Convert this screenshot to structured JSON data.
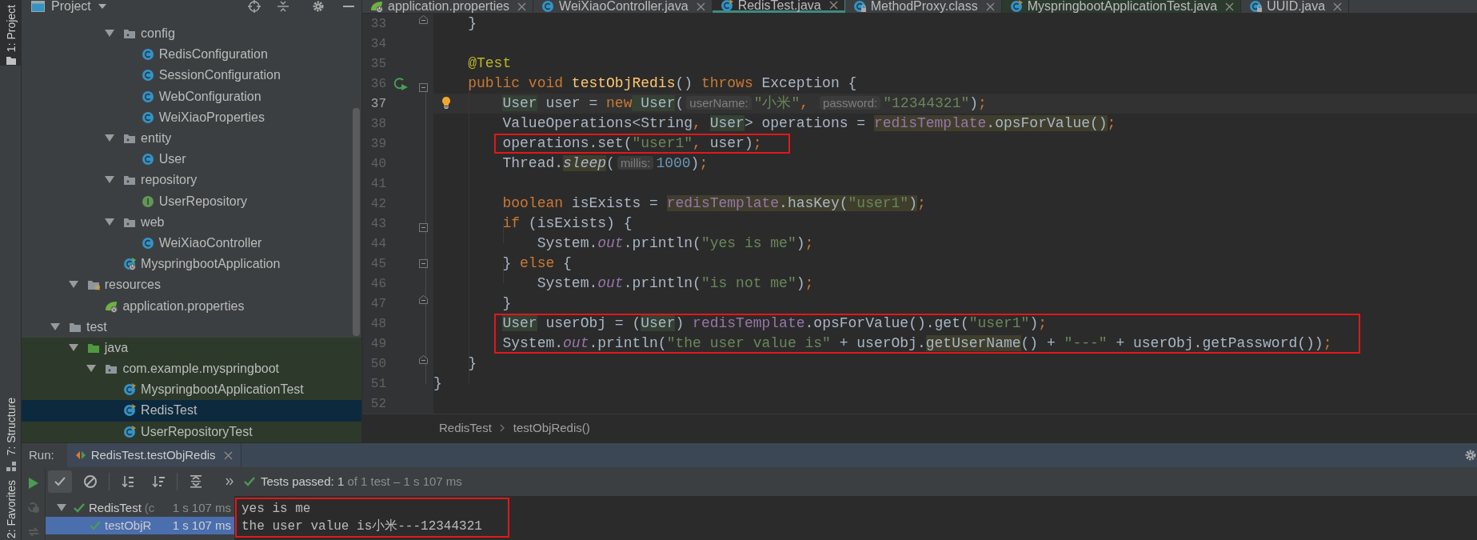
{
  "tool_stripe": {
    "top": [
      {
        "label": "1: Project",
        "selected": true
      }
    ],
    "bottom": [
      {
        "label": "7: Structure",
        "selected": false
      },
      {
        "label": "2: Favorites",
        "selected": false
      }
    ]
  },
  "project_panel": {
    "title": "Project",
    "tree": {
      "main_package_children": [
        {
          "label": "config",
          "kind": "package",
          "expanded": true,
          "selected": false,
          "children": [
            {
              "label": "RedisConfiguration",
              "kind": "class",
              "selected": false
            },
            {
              "label": "SessionConfiguration",
              "kind": "class",
              "selected": false
            },
            {
              "label": "WebConfiguration",
              "kind": "class",
              "selected": false
            },
            {
              "label": "WeiXiaoProperties",
              "kind": "class",
              "selected": false
            }
          ]
        },
        {
          "label": "entity",
          "kind": "package",
          "expanded": true,
          "selected": false,
          "children": [
            {
              "label": "User",
              "kind": "class",
              "selected": false
            }
          ]
        },
        {
          "label": "repository",
          "kind": "package",
          "expanded": true,
          "selected": false,
          "children": [
            {
              "label": "UserRepository",
              "kind": "interface",
              "selected": false
            }
          ]
        },
        {
          "label": "web",
          "kind": "package",
          "expanded": true,
          "selected": false,
          "children": [
            {
              "label": "WeiXiaoController",
              "kind": "class",
              "selected": false
            }
          ]
        },
        {
          "label": "MyspringbootApplication",
          "kind": "spring_app",
          "selected": false
        }
      ],
      "main_folders": [
        {
          "label": "resources",
          "kind": "resources_folder",
          "expanded": true,
          "selected": false,
          "children": [
            {
              "label": "application.properties",
              "kind": "spring_properties",
              "selected": false
            }
          ]
        }
      ],
      "roots": [
        {
          "label": "test",
          "kind": "folder",
          "expanded": true,
          "selected": false,
          "children": [
            {
              "label": "java",
              "kind": "test_sources_root",
              "expanded": true,
              "selected": false,
              "children": [
                {
                  "label": "com.example.myspringboot",
                  "kind": "package",
                  "expanded": true,
                  "selected": false,
                  "children": [
                    {
                      "label": "MyspringbootApplicationTest",
                      "kind": "test_class",
                      "selected": false
                    },
                    {
                      "label": "RedisTest",
                      "kind": "test_class",
                      "selected": true
                    },
                    {
                      "label": "UserRepositoryTest",
                      "kind": "test_class",
                      "selected": false
                    }
                  ]
                }
              ]
            }
          ]
        }
      ]
    }
  },
  "editor": {
    "tabs": [
      {
        "label": "application.properties",
        "kind": "spring_properties",
        "selected": false
      },
      {
        "label": "WeiXiaoController.java",
        "kind": "class",
        "selected": false
      },
      {
        "label": "RedisTest.java",
        "kind": "test_class",
        "selected": true
      },
      {
        "label": "MethodProxy.class",
        "kind": "library_class",
        "selected": false
      },
      {
        "label": "MyspringbootApplicationTest.java",
        "kind": "test_class",
        "selected": false
      },
      {
        "label": "UUID.java",
        "kind": "library_class",
        "selected": false
      }
    ],
    "lines": [
      {
        "number": "33",
        "current": false,
        "boxed": false,
        "fold": {
          "kind": "end"
        },
        "tokens": [
          {
            "kind": "plain",
            "text": "    }"
          }
        ]
      },
      {
        "number": "34",
        "current": false,
        "boxed": false
      },
      {
        "number": "35",
        "current": false,
        "boxed": false,
        "tokens": [
          {
            "kind": "annotation",
            "text": "    @Test"
          }
        ]
      },
      {
        "number": "36",
        "current": false,
        "boxed": false,
        "fold": {
          "kind": "start"
        },
        "gutter_icon": {
          "kind": "run"
        },
        "tokens": [
          {
            "kind": "kw",
            "text": "    public void"
          },
          {
            "kind": "method_decl",
            "text": " testObjRedis"
          },
          {
            "kind": "plain",
            "text": "() "
          },
          {
            "kind": "kw",
            "text": "throws"
          },
          {
            "kind": "plain",
            "text": " Exception {"
          }
        ]
      },
      {
        "number": "37",
        "current": true,
        "boxed": false,
        "gutter_icon": {
          "kind": "bulb"
        },
        "tokens": [
          {
            "kind": "type_hl",
            "text": "        User"
          },
          {
            "kind": "plain",
            "text": " user = "
          },
          {
            "kind": "kw",
            "text": "new"
          },
          {
            "kind": "type_hl",
            "text": " User"
          },
          {
            "kind": "plain",
            "text": "("
          },
          {
            "kind": "hint",
            "text": "userName:"
          },
          {
            "kind": "string",
            "text": "\"小米\""
          },
          {
            "kind": "punct",
            "text": ", "
          },
          {
            "kind": "hint",
            "text": "password:"
          },
          {
            "kind": "string",
            "text": "\"12344321\""
          },
          {
            "kind": "plain",
            "text": ")"
          },
          {
            "kind": "punct",
            "text": ";"
          }
        ]
      },
      {
        "number": "38",
        "current": false,
        "boxed": false,
        "tokens": [
          {
            "kind": "plain",
            "text": "        ValueOperations<String"
          },
          {
            "kind": "punct",
            "text": ", "
          },
          {
            "kind": "type_hl",
            "text": "User"
          },
          {
            "kind": "plain",
            "text": "> operations = "
          },
          {
            "kind": "field_hl",
            "text": "redisTemplate"
          },
          {
            "kind": "plain_hl",
            "text": ".opsForValue()"
          },
          {
            "kind": "punct",
            "text": ";"
          }
        ]
      },
      {
        "number": "39",
        "current": false,
        "boxed": true,
        "tokens": [
          {
            "kind": "plain",
            "text": "        operations.set("
          },
          {
            "kind": "string",
            "text": "\"user1\""
          },
          {
            "kind": "punct",
            "text": ", "
          },
          {
            "kind": "plain",
            "text": "user)"
          },
          {
            "kind": "punct",
            "text": ";"
          }
        ]
      },
      {
        "number": "40",
        "current": false,
        "boxed": false,
        "tokens": [
          {
            "kind": "plain",
            "text": "        Thread."
          },
          {
            "kind": "static_hl",
            "text": "sleep"
          },
          {
            "kind": "plain",
            "text": "("
          },
          {
            "kind": "hint",
            "text": "millis:"
          },
          {
            "kind": "number",
            "text": "1000"
          },
          {
            "kind": "plain",
            "text": ")"
          },
          {
            "kind": "punct",
            "text": ";"
          }
        ]
      },
      {
        "number": "41",
        "current": false,
        "boxed": false
      },
      {
        "number": "42",
        "current": false,
        "boxed": false,
        "tokens": [
          {
            "kind": "kw",
            "text": "        boolean"
          },
          {
            "kind": "plain",
            "text": " isExists = "
          },
          {
            "kind": "field_hl",
            "text": "redisTemplate"
          },
          {
            "kind": "plain_hl",
            "text": ".hasKey("
          },
          {
            "kind": "string_hl",
            "text": "\"user1\""
          },
          {
            "kind": "plain_hl",
            "text": ")"
          },
          {
            "kind": "punct",
            "text": ";"
          }
        ]
      },
      {
        "number": "43",
        "current": false,
        "boxed": false,
        "fold": {
          "kind": "start"
        },
        "tokens": [
          {
            "kind": "kw",
            "text": "        if"
          },
          {
            "kind": "plain",
            "text": " (isExists) {"
          }
        ]
      },
      {
        "number": "44",
        "current": false,
        "boxed": false,
        "tokens": [
          {
            "kind": "plain",
            "text": "            System."
          },
          {
            "kind": "static_field",
            "text": "out"
          },
          {
            "kind": "plain",
            "text": ".println("
          },
          {
            "kind": "string",
            "text": "\"yes is me\""
          },
          {
            "kind": "plain",
            "text": ")"
          },
          {
            "kind": "punct",
            "text": ";"
          }
        ]
      },
      {
        "number": "45",
        "current": false,
        "boxed": false,
        "fold": {
          "kind": "both"
        },
        "tokens": [
          {
            "kind": "plain",
            "text": "        } "
          },
          {
            "kind": "kw",
            "text": "else"
          },
          {
            "kind": "plain",
            "text": " {"
          }
        ]
      },
      {
        "number": "46",
        "current": false,
        "boxed": false,
        "tokens": [
          {
            "kind": "plain",
            "text": "            System."
          },
          {
            "kind": "static_field",
            "text": "out"
          },
          {
            "kind": "plain",
            "text": ".println("
          },
          {
            "kind": "string",
            "text": "\"is not me\""
          },
          {
            "kind": "plain",
            "text": ")"
          },
          {
            "kind": "punct",
            "text": ";"
          }
        ]
      },
      {
        "number": "47",
        "current": false,
        "boxed": false,
        "fold": {
          "kind": "end"
        },
        "tokens": [
          {
            "kind": "plain",
            "text": "        }"
          }
        ]
      },
      {
        "number": "48",
        "current": false,
        "boxed": true,
        "tokens": [
          {
            "kind": "type_hl",
            "text": "        User"
          },
          {
            "kind": "plain",
            "text": " userObj = ("
          },
          {
            "kind": "type_hl",
            "text": "User"
          },
          {
            "kind": "plain",
            "text": ") "
          },
          {
            "kind": "field",
            "text": "redisTemplate"
          },
          {
            "kind": "plain",
            "text": ".opsForValue().get("
          },
          {
            "kind": "string",
            "text": "\"user1\""
          },
          {
            "kind": "plain",
            "text": ")"
          },
          {
            "kind": "punct",
            "text": ";"
          }
        ]
      },
      {
        "number": "49",
        "current": false,
        "boxed": true,
        "tokens": [
          {
            "kind": "plain",
            "text": "        System."
          },
          {
            "kind": "static_field",
            "text": "out"
          },
          {
            "kind": "plain",
            "text": ".println("
          },
          {
            "kind": "string",
            "text": "\"the user value is\""
          },
          {
            "kind": "plain",
            "text": " + userObj."
          },
          {
            "kind": "plain_hl",
            "text": "getUserName"
          },
          {
            "kind": "plain",
            "text": "() + "
          },
          {
            "kind": "string",
            "text": "\"---\""
          },
          {
            "kind": "plain",
            "text": " + userObj.getPassword())"
          },
          {
            "kind": "punct",
            "text": ";"
          }
        ]
      },
      {
        "number": "50",
        "current": false,
        "boxed": false,
        "fold": {
          "kind": "end"
        },
        "tokens": [
          {
            "kind": "plain",
            "text": "    }"
          }
        ]
      },
      {
        "number": "51",
        "current": false,
        "boxed": false,
        "tokens": [
          {
            "kind": "plain",
            "text": "}"
          }
        ]
      },
      {
        "number": "52",
        "current": false,
        "boxed": false
      }
    ],
    "breadcrumb": [
      "RedisTest",
      "testObjRedis()"
    ]
  },
  "run_panel": {
    "label": "Run:",
    "tab": {
      "label": "RedisTest.testObjRedis",
      "selected": true
    },
    "toolbar": [
      {
        "kind": "show_passed",
        "on": true
      },
      {
        "kind": "show_ignored",
        "on": false
      },
      {
        "kind": "sort_alpha",
        "on": false
      },
      {
        "kind": "sort_duration",
        "on": false
      },
      {
        "kind": "expand",
        "on": false
      },
      {
        "kind": "more",
        "on": false
      }
    ],
    "status": {
      "passed": "Tests passed: 1",
      "detail": "of 1 test – 1 s 107 ms"
    },
    "tests": [
      {
        "label": "RedisTest",
        "detail": "(c",
        "time": "1 s 107 ms",
        "passed": true,
        "expanded": true,
        "selected": false,
        "children": [
          {
            "label": "testObjR",
            "time": "1 s 107 ms",
            "passed": true,
            "selected": true
          }
        ]
      }
    ],
    "console": {
      "boxed": true,
      "lines": [
        "yes is me",
        "the user value is小米---12344321"
      ]
    }
  }
}
